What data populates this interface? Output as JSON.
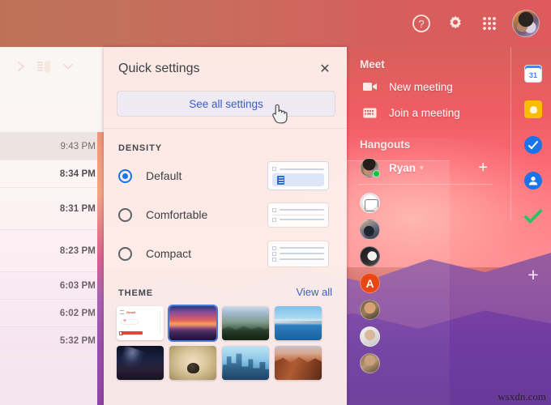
{
  "theme_colors": {
    "header_left": "#bd7257",
    "header_right": "#de5a5d",
    "accent_blue": "#1a73e8",
    "link_blue": "#3b5fc0",
    "panel_bg": "#fdeeea",
    "sky_top": "#c4685c",
    "sky_mid": "#ef5d63",
    "sky_low": "#ff8f93",
    "ridge_far": "#9a5f9e",
    "ridge_near": "#7d44a6"
  },
  "header": {
    "icons": [
      {
        "name": "help-icon",
        "label": "Support"
      },
      {
        "name": "gear-icon",
        "label": "Settings"
      },
      {
        "name": "apps-grid-icon",
        "label": "Google apps"
      }
    ],
    "avatar_label": "Google Account"
  },
  "left_toolbar": {
    "expand_label": "›",
    "reading_pane_label": "Toggle split pane mode",
    "caret_label": "▾"
  },
  "mail_list": {
    "rows": [
      {
        "time": "9:43 PM",
        "state": "read"
      },
      {
        "time": "8:34 PM",
        "state": "unread"
      },
      {
        "time": "8:31 PM",
        "state": "unread"
      },
      {
        "time": "8:23 PM",
        "state": "unread"
      },
      {
        "time": "6:03 PM",
        "state": "unread"
      },
      {
        "time": "6:02 PM",
        "state": "unread"
      },
      {
        "time": "5:32 PM",
        "state": "unread"
      }
    ]
  },
  "quick_settings": {
    "title": "Quick settings",
    "close_label": "✕",
    "see_all_label": "See all settings",
    "density": {
      "section_label": "DENSITY",
      "options": [
        {
          "label": "Default",
          "selected": true
        },
        {
          "label": "Comfortable",
          "selected": false
        },
        {
          "label": "Compact",
          "selected": false
        }
      ]
    },
    "theme": {
      "section_label": "THEME",
      "view_all_label": "View all",
      "thumbnails": [
        {
          "name": "default-light",
          "selected": false
        },
        {
          "name": "sunset-mountains",
          "selected": true
        },
        {
          "name": "alpine-forest",
          "selected": false
        },
        {
          "name": "blue-lake",
          "selected": false
        },
        {
          "name": "night-sky",
          "selected": false
        },
        {
          "name": "desert-rock",
          "selected": false
        },
        {
          "name": "city-skyline",
          "selected": false
        },
        {
          "name": "red-canyon",
          "selected": false
        }
      ]
    }
  },
  "right_panel": {
    "meet": {
      "title": "Meet",
      "items": [
        {
          "label": "New meeting",
          "icon": "video-camera-icon"
        },
        {
          "label": "Join a meeting",
          "icon": "keyboard-icon"
        }
      ]
    },
    "hangouts": {
      "title": "Hangouts",
      "active_user": "Ryan",
      "caret_label": "▾",
      "add_label": "+",
      "contacts": [
        {
          "name": "contact-1",
          "avatar": "a1"
        },
        {
          "name": "contact-2",
          "avatar": "a2"
        },
        {
          "name": "contact-3",
          "avatar": "a3"
        },
        {
          "name": "contact-4",
          "avatar": "a4",
          "initial": "A"
        },
        {
          "name": "contact-5",
          "avatar": "a5"
        },
        {
          "name": "contact-6",
          "avatar": "a6"
        },
        {
          "name": "contact-7",
          "avatar": "a7"
        }
      ]
    }
  },
  "app_rail": {
    "items": [
      {
        "name": "calendar-icon",
        "label": "Calendar",
        "badge": "31"
      },
      {
        "name": "keep-icon",
        "label": "Keep"
      },
      {
        "name": "tasks-icon",
        "label": "Tasks"
      },
      {
        "name": "contacts-icon",
        "label": "Contacts"
      },
      {
        "name": "green-check-icon",
        "label": "Get add-ons"
      }
    ],
    "add_label": "+"
  },
  "watermark": {
    "text": "wsxdn.com"
  }
}
